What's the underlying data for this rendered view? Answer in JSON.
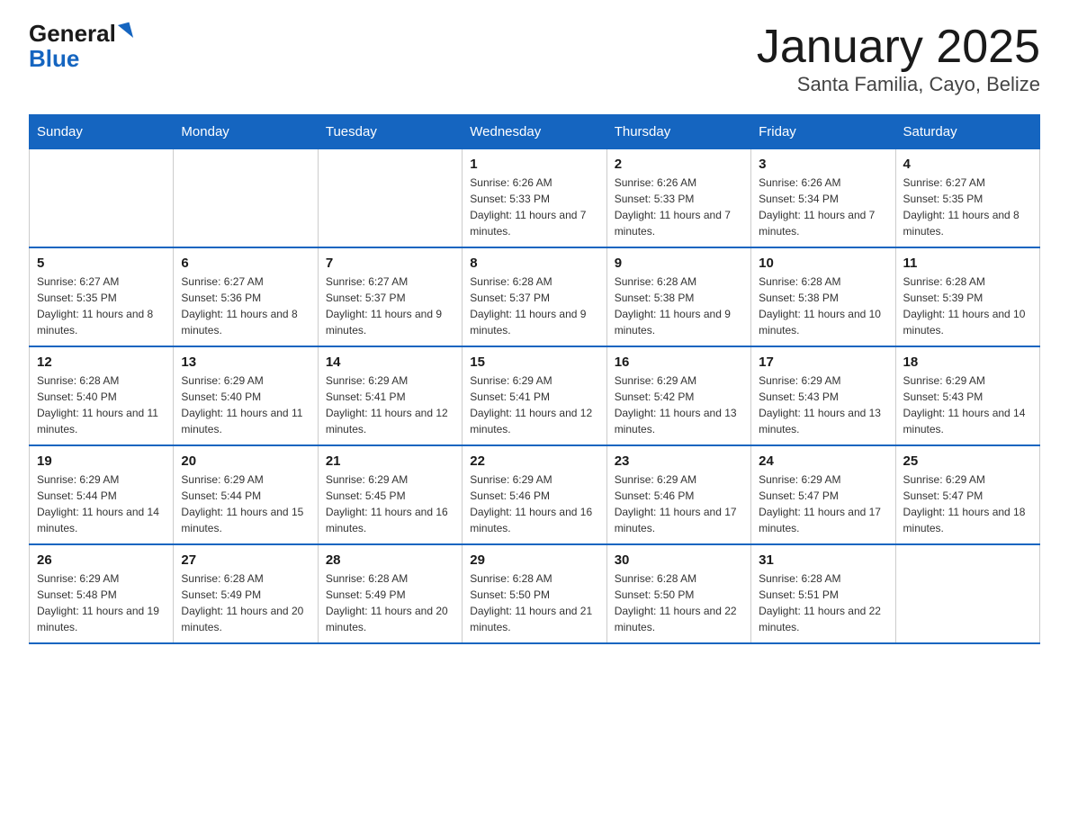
{
  "header": {
    "logo_general": "General",
    "logo_blue": "Blue",
    "title": "January 2025",
    "subtitle": "Santa Familia, Cayo, Belize"
  },
  "days_of_week": [
    "Sunday",
    "Monday",
    "Tuesday",
    "Wednesday",
    "Thursday",
    "Friday",
    "Saturday"
  ],
  "weeks": [
    [
      {
        "day": "",
        "info": ""
      },
      {
        "day": "",
        "info": ""
      },
      {
        "day": "",
        "info": ""
      },
      {
        "day": "1",
        "info": "Sunrise: 6:26 AM\nSunset: 5:33 PM\nDaylight: 11 hours and 7 minutes."
      },
      {
        "day": "2",
        "info": "Sunrise: 6:26 AM\nSunset: 5:33 PM\nDaylight: 11 hours and 7 minutes."
      },
      {
        "day": "3",
        "info": "Sunrise: 6:26 AM\nSunset: 5:34 PM\nDaylight: 11 hours and 7 minutes."
      },
      {
        "day": "4",
        "info": "Sunrise: 6:27 AM\nSunset: 5:35 PM\nDaylight: 11 hours and 8 minutes."
      }
    ],
    [
      {
        "day": "5",
        "info": "Sunrise: 6:27 AM\nSunset: 5:35 PM\nDaylight: 11 hours and 8 minutes."
      },
      {
        "day": "6",
        "info": "Sunrise: 6:27 AM\nSunset: 5:36 PM\nDaylight: 11 hours and 8 minutes."
      },
      {
        "day": "7",
        "info": "Sunrise: 6:27 AM\nSunset: 5:37 PM\nDaylight: 11 hours and 9 minutes."
      },
      {
        "day": "8",
        "info": "Sunrise: 6:28 AM\nSunset: 5:37 PM\nDaylight: 11 hours and 9 minutes."
      },
      {
        "day": "9",
        "info": "Sunrise: 6:28 AM\nSunset: 5:38 PM\nDaylight: 11 hours and 9 minutes."
      },
      {
        "day": "10",
        "info": "Sunrise: 6:28 AM\nSunset: 5:38 PM\nDaylight: 11 hours and 10 minutes."
      },
      {
        "day": "11",
        "info": "Sunrise: 6:28 AM\nSunset: 5:39 PM\nDaylight: 11 hours and 10 minutes."
      }
    ],
    [
      {
        "day": "12",
        "info": "Sunrise: 6:28 AM\nSunset: 5:40 PM\nDaylight: 11 hours and 11 minutes."
      },
      {
        "day": "13",
        "info": "Sunrise: 6:29 AM\nSunset: 5:40 PM\nDaylight: 11 hours and 11 minutes."
      },
      {
        "day": "14",
        "info": "Sunrise: 6:29 AM\nSunset: 5:41 PM\nDaylight: 11 hours and 12 minutes."
      },
      {
        "day": "15",
        "info": "Sunrise: 6:29 AM\nSunset: 5:41 PM\nDaylight: 11 hours and 12 minutes."
      },
      {
        "day": "16",
        "info": "Sunrise: 6:29 AM\nSunset: 5:42 PM\nDaylight: 11 hours and 13 minutes."
      },
      {
        "day": "17",
        "info": "Sunrise: 6:29 AM\nSunset: 5:43 PM\nDaylight: 11 hours and 13 minutes."
      },
      {
        "day": "18",
        "info": "Sunrise: 6:29 AM\nSunset: 5:43 PM\nDaylight: 11 hours and 14 minutes."
      }
    ],
    [
      {
        "day": "19",
        "info": "Sunrise: 6:29 AM\nSunset: 5:44 PM\nDaylight: 11 hours and 14 minutes."
      },
      {
        "day": "20",
        "info": "Sunrise: 6:29 AM\nSunset: 5:44 PM\nDaylight: 11 hours and 15 minutes."
      },
      {
        "day": "21",
        "info": "Sunrise: 6:29 AM\nSunset: 5:45 PM\nDaylight: 11 hours and 16 minutes."
      },
      {
        "day": "22",
        "info": "Sunrise: 6:29 AM\nSunset: 5:46 PM\nDaylight: 11 hours and 16 minutes."
      },
      {
        "day": "23",
        "info": "Sunrise: 6:29 AM\nSunset: 5:46 PM\nDaylight: 11 hours and 17 minutes."
      },
      {
        "day": "24",
        "info": "Sunrise: 6:29 AM\nSunset: 5:47 PM\nDaylight: 11 hours and 17 minutes."
      },
      {
        "day": "25",
        "info": "Sunrise: 6:29 AM\nSunset: 5:47 PM\nDaylight: 11 hours and 18 minutes."
      }
    ],
    [
      {
        "day": "26",
        "info": "Sunrise: 6:29 AM\nSunset: 5:48 PM\nDaylight: 11 hours and 19 minutes."
      },
      {
        "day": "27",
        "info": "Sunrise: 6:28 AM\nSunset: 5:49 PM\nDaylight: 11 hours and 20 minutes."
      },
      {
        "day": "28",
        "info": "Sunrise: 6:28 AM\nSunset: 5:49 PM\nDaylight: 11 hours and 20 minutes."
      },
      {
        "day": "29",
        "info": "Sunrise: 6:28 AM\nSunset: 5:50 PM\nDaylight: 11 hours and 21 minutes."
      },
      {
        "day": "30",
        "info": "Sunrise: 6:28 AM\nSunset: 5:50 PM\nDaylight: 11 hours and 22 minutes."
      },
      {
        "day": "31",
        "info": "Sunrise: 6:28 AM\nSunset: 5:51 PM\nDaylight: 11 hours and 22 minutes."
      },
      {
        "day": "",
        "info": ""
      }
    ]
  ]
}
